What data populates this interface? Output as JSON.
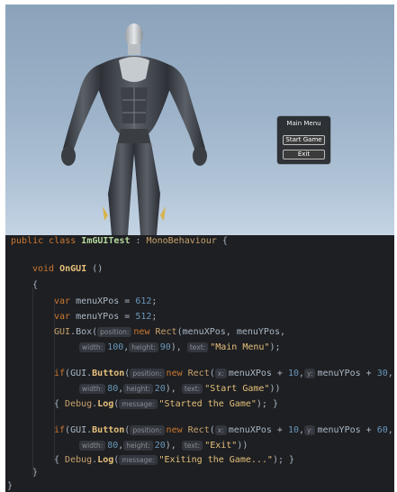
{
  "game_view": {
    "menu_box": {
      "title": "Main Menu",
      "start_button_label": "Start Game",
      "exit_button_label": "Exit"
    }
  },
  "code": {
    "l1": {
      "kw_public": "public",
      "kw_class": "class",
      "class_name": "ImGUITest",
      "colon": " : ",
      "base": "MonoBehaviour",
      "brace": " {"
    },
    "l2": {
      "kw_void": "void",
      "method": "OnGUI",
      "parens": " ()"
    },
    "l3": {
      "brace": "{"
    },
    "l4": {
      "kw_var": "var",
      "rest": " menuXPos = ",
      "num": "612",
      "semi": ";"
    },
    "l5": {
      "kw_var": "var",
      "rest": " menuYPos = ",
      "num": "512",
      "semi": ";"
    },
    "l6": {
      "gui": "GUI",
      "box": ".Box(",
      "hint_position": "position:",
      "kw_new": "new ",
      "rect": "Rect",
      "args": "(menuXPos, menuYPos,"
    },
    "l7": {
      "hint_width": "width:",
      "num_w": "100",
      "comma1": ",",
      "hint_height": "height:",
      "num_h": "90",
      "close": "),",
      "hint_text": "text:",
      "str": "\"Main Menu\"",
      "end": ");"
    },
    "l8": {
      "kw_if": "if",
      "open": "(GUI.",
      "button": "Button",
      "paren": "(",
      "hint_position": "position:",
      "kw_new": "new ",
      "rect": "Rect",
      "p2": "(",
      "hint_x": "x:",
      "a1": "menuXPos + ",
      "n1": "10",
      "c1": ",",
      "hint_y": "y:",
      "a2": "menuYPos + ",
      "n2": "30",
      "c2": ","
    },
    "l9": {
      "hint_width": "width:",
      "num_w": "80",
      "comma1": ",",
      "hint_height": "height:",
      "num_h": "20",
      "close": "),",
      "hint_text": "text:",
      "str": "\"Start Game\"",
      "end": "))"
    },
    "l10": {
      "brace": "{ ",
      "debug": "Debug",
      "dot": ".",
      "log": "Log",
      "paren": "(",
      "hint_message": "message:",
      "str": "\"Started the Game\"",
      "end": "); }"
    },
    "l11": {
      "kw_if": "if",
      "open": "(GUI.",
      "button": "Button",
      "paren": "(",
      "hint_position": "position:",
      "kw_new": "new ",
      "rect": "Rect",
      "p2": "(",
      "hint_x": "x:",
      "a1": "menuXPos + ",
      "n1": "10",
      "c1": ",",
      "hint_y": "y:",
      "a2": "menuYPos + ",
      "n2": "60",
      "c2": ","
    },
    "l12": {
      "hint_width": "width:",
      "num_w": "80",
      "comma1": ",",
      "hint_height": "height:",
      "num_h": "20",
      "close": "),",
      "hint_text": "text:",
      "str": "\"Exit\"",
      "end": "))"
    },
    "l13": {
      "brace": "{ ",
      "debug": "Debug",
      "dot": ".",
      "log": "Log",
      "paren": "(",
      "hint_message": "message:",
      "str": "\"Exiting the Game...\"",
      "end": "); }"
    },
    "l14": {
      "brace": "}"
    },
    "l15": {
      "brace": "}"
    }
  }
}
